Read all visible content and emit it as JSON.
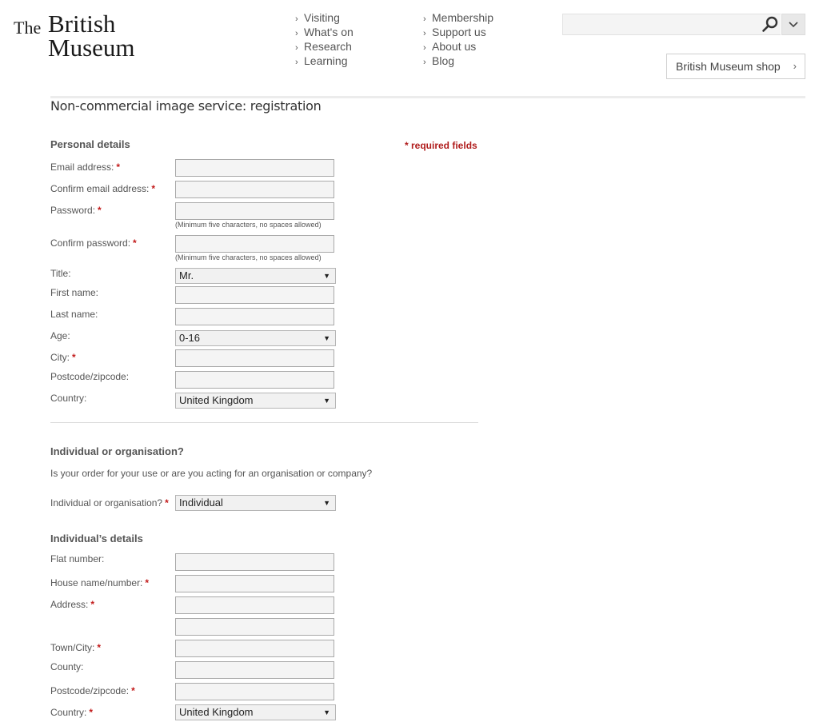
{
  "header": {
    "logo_the": "The",
    "logo_british": "British",
    "logo_museum": "Museum",
    "nav_col1": [
      "Visiting",
      "What's on",
      "Research",
      "Learning"
    ],
    "nav_col2": [
      "Membership",
      "Support us",
      "About us",
      "Blog"
    ],
    "search_placeholder": "",
    "shop_label": "British Museum shop",
    "icons": {
      "search": "search-icon",
      "dropdown": "chevron-down-icon",
      "shop_arrow": "chevron-right-icon",
      "nav": "chevron-right-icon"
    }
  },
  "page": {
    "title": "Non-commercial image service: registration"
  },
  "personal": {
    "heading": "Personal details",
    "required_note": "* required fields",
    "email_label": "Email address:",
    "confirm_email_label": "Confirm email address:",
    "password_label": "Password:",
    "password_hint": "(Minimum five characters, no spaces allowed)",
    "confirm_password_label": "Confirm password:",
    "confirm_password_hint": "(Minimum five characters, no spaces allowed)",
    "title_label": "Title:",
    "title_value": "Mr.",
    "first_name_label": "First name:",
    "last_name_label": "Last name:",
    "age_label": "Age:",
    "age_value": "0-16",
    "city_label": "City:",
    "postcode_label": "Postcode/zipcode:",
    "country_label": "Country:",
    "country_value": "United Kingdom"
  },
  "org": {
    "heading": "Individual or organisation?",
    "question": "Is your order for your use or are you acting for an organisation or company?",
    "select_label": "Individual or organisation?",
    "select_value": "Individual"
  },
  "individual": {
    "heading": "Individual’s details",
    "flat_label": "Flat number:",
    "house_label": "House name/number:",
    "address_label": "Address:",
    "town_label": "Town/City:",
    "county_label": "County:",
    "postcode_label": "Postcode/zipcode:",
    "country_label": "Country:",
    "country_value": "United Kingdom"
  },
  "colors": {
    "required": "#c21a1a",
    "field_bg": "#f4f4f4",
    "text": "#555555"
  }
}
